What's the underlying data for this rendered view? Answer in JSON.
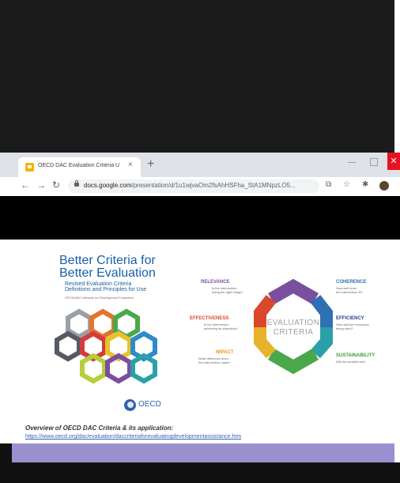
{
  "browser": {
    "tab_title": "OECD DAC Evaluation Criteria U",
    "tab_close": "×",
    "new_tab": "+",
    "url_host": "docs.google.com",
    "url_path": "/presentation/d/1u1wjvaOm2fsAhHSFha_StA1MNpzLO5...",
    "close_glyph": "✕"
  },
  "slide": {
    "title_line1": "Better Criteria for",
    "title_line2": "Better Evaluation",
    "subtitle_line1": "Revised Evaluation Criteria",
    "subtitle_line2": "Definitions and Principles for Use",
    "network": "OECD/DAC Network on Development Evaluation",
    "center_line1": "EVALUATION",
    "center_line2": "CRITERIA",
    "criteria": {
      "relevance": {
        "title": "RELEVANCE",
        "q1": "Is the intervention",
        "q2": "doing the right things?",
        "color": "#7b4fa0"
      },
      "coherence": {
        "title": "COHERENCE",
        "q1": "How well does",
        "q2": "the intervention fit?",
        "color": "#2f6fb3"
      },
      "effectiveness": {
        "title": "EFFECTIVENESS",
        "q1": "Is the intervention",
        "q2": "achieving its objectives?",
        "color": "#d9482b"
      },
      "efficiency": {
        "title": "EFFICIENCY",
        "q1": "How well are resources",
        "q2": "being used?",
        "color": "#2d3b88"
      },
      "impact": {
        "title": "IMPACT",
        "q1": "What difference does",
        "q2": "the intervention make?",
        "color": "#e69a1f"
      },
      "sustainability": {
        "title": "SUSTAINABILITY",
        "q1": "Will the benefits last?",
        "q2": "",
        "color": "#3f9a3a"
      }
    },
    "oecd_label": "OECD",
    "overview": "Overview of OECD DAC Criteria & its application:",
    "link": "https://www.oecd.org/dac/evaluation/daccriteriaforevaluatingdevelopmentassistance.htm"
  }
}
